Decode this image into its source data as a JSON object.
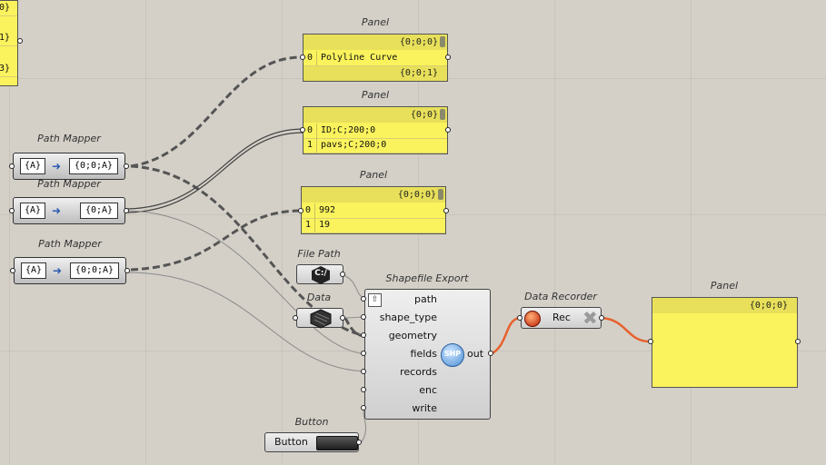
{
  "captions": {
    "panel_top": "Panel",
    "panel_mid": "Panel",
    "panel_low": "Panel",
    "panel_right": "Panel",
    "path_mapper_1": "Path Mapper",
    "path_mapper_2": "Path Mapper",
    "path_mapper_3": "Path Mapper",
    "file_path": "File Path",
    "data": "Data",
    "shapefile_export": "Shapefile Export",
    "data_recorder": "Data Recorder",
    "button": "Button"
  },
  "left_panel_partial": {
    "rows": [
      "0}",
      "1}",
      "3}"
    ]
  },
  "panel_top": {
    "header": "{0;0;0}",
    "rows": [
      {
        "idx": "0",
        "text": "Polyline Curve"
      }
    ],
    "footer": "{0;0;1}"
  },
  "panel_mid": {
    "header": "{0;0}",
    "rows": [
      {
        "idx": "0",
        "text": "ID;C;200;0"
      },
      {
        "idx": "1",
        "text": "pavs;C;200;0"
      }
    ]
  },
  "panel_low": {
    "header": "{0;0;0}",
    "rows": [
      {
        "idx": "0",
        "text": "992"
      },
      {
        "idx": "1",
        "text": "19"
      }
    ]
  },
  "panel_right": {
    "header": "{0;0;0}"
  },
  "path_mappers": [
    {
      "source": "{A}",
      "target": "{0;0;A}"
    },
    {
      "source": "{A}",
      "target": "{0;A}"
    },
    {
      "source": "{A}",
      "target": "{0;0;A}"
    }
  ],
  "file_path": {
    "icon_text": "C:/"
  },
  "shapefile": {
    "inputs": [
      "path",
      "shape_type",
      "geometry",
      "fields",
      "records",
      "enc",
      "write"
    ],
    "output": "out",
    "icon_text": "SHP"
  },
  "data_recorder": {
    "label": "Rec"
  },
  "button": {
    "label": "Button"
  },
  "colors": {
    "panel_yellow": "#fbf35d",
    "wire_active": "#e8602c",
    "canvas": "#d4d0c8"
  }
}
